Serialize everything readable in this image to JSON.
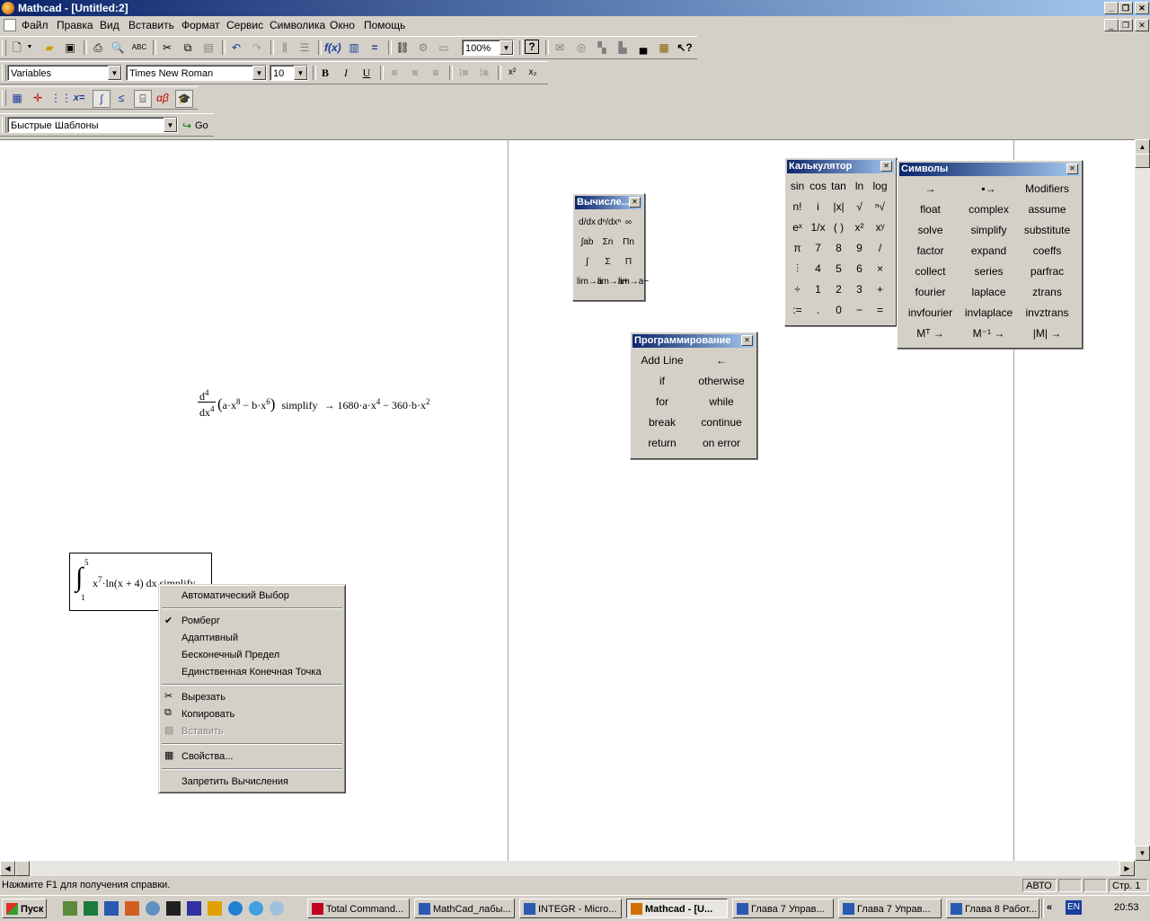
{
  "window": {
    "title": "Mathcad - [Untitled:2]"
  },
  "menu": [
    "Файл",
    "Правка",
    "Вид",
    "Вставить",
    "Формат",
    "Сервис",
    "Символика",
    "Окно",
    "Помощь"
  ],
  "toolbar": {
    "zoom": "100%"
  },
  "format_bar": {
    "style": "Variables",
    "font": "Times New Roman",
    "size": "10",
    "bold": "B",
    "italic": "I",
    "underline": "U"
  },
  "resources_bar": {
    "template": "Быстрые Шаблоны",
    "go": "Go"
  },
  "worksheet": {
    "eq1": {
      "lhs_num": "d",
      "lhs_num_exp": "4",
      "lhs_den": "dx",
      "lhs_den_exp": "4",
      "body": "a·x",
      "p1": "8",
      "mid": " − b·x",
      "p2": "6",
      "kw": "simplify",
      "arrow": "→",
      "rhs1": "1680·a·x",
      "rp1": "4",
      "rhs2": " − 360·b·x",
      "rp2": "2"
    },
    "eq2": {
      "upper": "5",
      "lower": "1",
      "body": "x",
      "p": "7",
      "rest": "·ln(x + 4) dx",
      "kw": "simplify"
    }
  },
  "context_menu": {
    "auto": "Автоматический Выбор",
    "romberg": "Ромберг",
    "adaptive": "Адаптивный",
    "infinite": "Бесконечный Предел",
    "single": "Единственная Конечная Точка",
    "cut": "Вырезать",
    "copy": "Копировать",
    "paste": "Вставить",
    "properties": "Свойства...",
    "disable": "Запретить Вычисления"
  },
  "palettes": {
    "calculus": {
      "title": "Вычисле...",
      "buttons": [
        "d/dx",
        "dⁿ/dxⁿ",
        "∞",
        "∫ab",
        "Σn",
        "Πn",
        "∫",
        "Σ",
        "Π",
        "lim→a",
        "lim→a+",
        "lim→a−"
      ]
    },
    "calculator": {
      "title": "Калькулятор",
      "buttons": [
        "sin",
        "cos",
        "tan",
        "ln",
        "log",
        "n!",
        "i",
        "|x|",
        "√",
        "ⁿ√",
        "eˣ",
        "1/x",
        "( )",
        "x²",
        "xʸ",
        "π",
        "7",
        "8",
        "9",
        "/",
        "⫶",
        "4",
        "5",
        "6",
        "×",
        "÷",
        "1",
        "2",
        "3",
        "+",
        ":=",
        ".",
        "0",
        "−",
        "="
      ]
    },
    "symbols": {
      "title": "Символы",
      "buttons": [
        "→",
        "▪→",
        "Modifiers",
        "float",
        "complex",
        "assume",
        "solve",
        "simplify",
        "substitute",
        "factor",
        "expand",
        "coeffs",
        "collect",
        "series",
        "parfrac",
        "fourier",
        "laplace",
        "ztrans",
        "invfourier",
        "invlaplace",
        "invztrans",
        "Mᵀ →",
        "M⁻¹ →",
        "|M| →"
      ]
    },
    "programming": {
      "title": "Программирование",
      "buttons": [
        "Add Line",
        "←",
        "if",
        "otherwise",
        "for",
        "while",
        "break",
        "continue",
        "return",
        "on error"
      ]
    }
  },
  "status": {
    "help": "Нажмите F1 для получения справки.",
    "mode": "АВТО",
    "page": "Стр. 1"
  },
  "taskbar": {
    "start": "Пуск",
    "tasks": [
      "Total Command...",
      "MathCad_лабы...",
      "INTEGR - Micro...",
      "Mathcad - [U...",
      "Глава 7 Управ...",
      "Глава 7 Управ...",
      "Глава 8 Работ..."
    ],
    "lang": "EN",
    "clock": "20:53"
  }
}
